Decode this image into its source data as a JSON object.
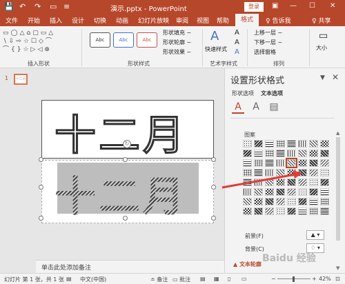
{
  "titlebar": {
    "save_icon": "💾",
    "undo_icon": "↶",
    "redo_icon": "↷",
    "present_icon": "▭",
    "quick_access_more": "≡",
    "title": "演示.pptx - PowerPoint",
    "login": "登录",
    "ribbon_options_icon": "▣",
    "minimize": "—",
    "maximize": "☐",
    "close": "✕"
  },
  "tabs": {
    "items": [
      "文件",
      "开始",
      "插入",
      "设计",
      "切换",
      "动画",
      "幻灯片放映",
      "审阅",
      "视图",
      "帮助"
    ],
    "format": "格式",
    "tell_me": "♀ 告诉我",
    "share": "♀ 共享"
  },
  "ribbon": {
    "insert_shapes_label": "插入形状",
    "shapes_glyphs": "▭◯△⌂▢▭△\n∖⇩⇨☆☐◇⌒\n⌒{}☆▷◁⊕",
    "shape_styles_label": "形状样式",
    "style_sample": "Abc",
    "shape_fill": "形状填充 ~",
    "shape_outline": "形状轮廓 ~",
    "shape_effects": "形状效果 ~",
    "quick_styles": "快速样式",
    "wordart_styles_label": "艺术字样式",
    "bring_forward": "上移一层 ~",
    "send_backward": "下移一层 ~",
    "selection_pane": "选择窗格",
    "arrange_label": "排列",
    "size": "大小"
  },
  "slides": {
    "number": "1",
    "thumb_text": "十二月"
  },
  "slide": {
    "text_top": "十二月",
    "text_bottom": "十二月"
  },
  "notes": {
    "placeholder": "单击此处添加备注"
  },
  "pane": {
    "title": "设置形状格式",
    "options_icon": "▼",
    "close": "✕",
    "tab_shape": "形状选项",
    "tab_text": "文本选项",
    "fill_icon": "A",
    "effect_icon": "A",
    "textbox_icon": "▤",
    "pattern_label": "图案",
    "fg_label": "前景(F)",
    "bg_label": "背景(C)",
    "fg_picker": "▲ ▾",
    "bg_picker": "♢ ▾",
    "wordart_section": "▲ 文本轮廓",
    "scroll_up": "▲",
    "scroll_down": "▼"
  },
  "status": {
    "slide_info": "幻灯片 第 1 张，共 1 张",
    "accessibility_icon": "▤",
    "language": "中文(中国)",
    "notes": "≐ 备注",
    "comments": "▭ 批注",
    "normal_view_icon": "▤",
    "sorter_view_icon": "▦",
    "reading_view_icon": "▯",
    "slideshow_icon": "▭",
    "zoom_minus": "−",
    "zoom_plus": "+",
    "zoom": "42%",
    "fit_icon": "⊡"
  },
  "watermark": "Baidu 经验",
  "colors": {
    "accent": "#b7472a",
    "annotation": "#e53935"
  }
}
